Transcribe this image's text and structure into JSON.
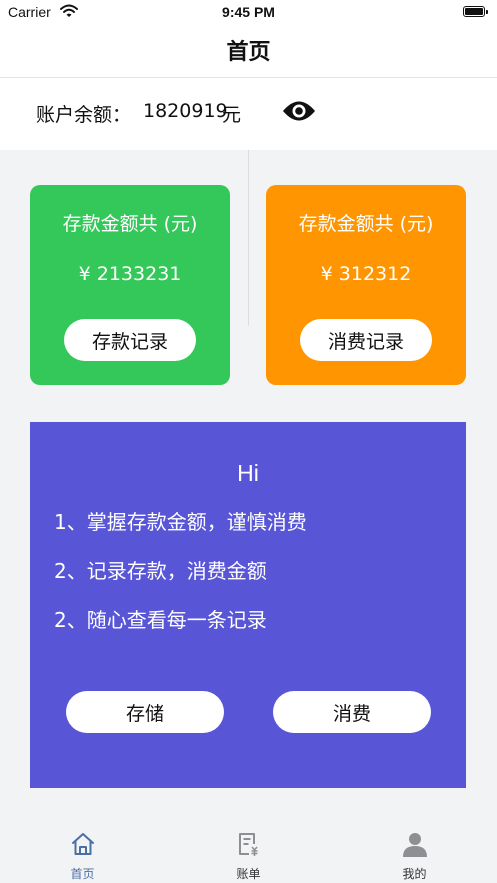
{
  "status_bar": {
    "carrier": "Carrier",
    "time": "9:45 PM"
  },
  "nav": {
    "title": "首页"
  },
  "balance": {
    "label": "账户余额：",
    "value": "1820919",
    "unit": "元"
  },
  "cards": [
    {
      "title": "存款金额共 (元)",
      "amount": "¥ 2133231",
      "button": "存款记录",
      "color": "#34c759"
    },
    {
      "title": "存款金额共 (元)",
      "amount": "¥ 312312",
      "button": "消费记录",
      "color": "#ff9500"
    }
  ],
  "info": {
    "title": "Hi",
    "lines": [
      "1、掌握存款金额，谨慎消费",
      "2、记录存款，消费金额",
      "2、随心查看每一条记录"
    ],
    "save_button": "存储",
    "spend_button": "消费",
    "color": "#5856d6"
  },
  "tabs": [
    {
      "label": "首页",
      "active": true
    },
    {
      "label": "账单",
      "active": false
    },
    {
      "label": "我的",
      "active": false
    }
  ],
  "colors": {
    "tab_active": "#4a6fa5",
    "tab_inactive": "#8e8e93"
  }
}
